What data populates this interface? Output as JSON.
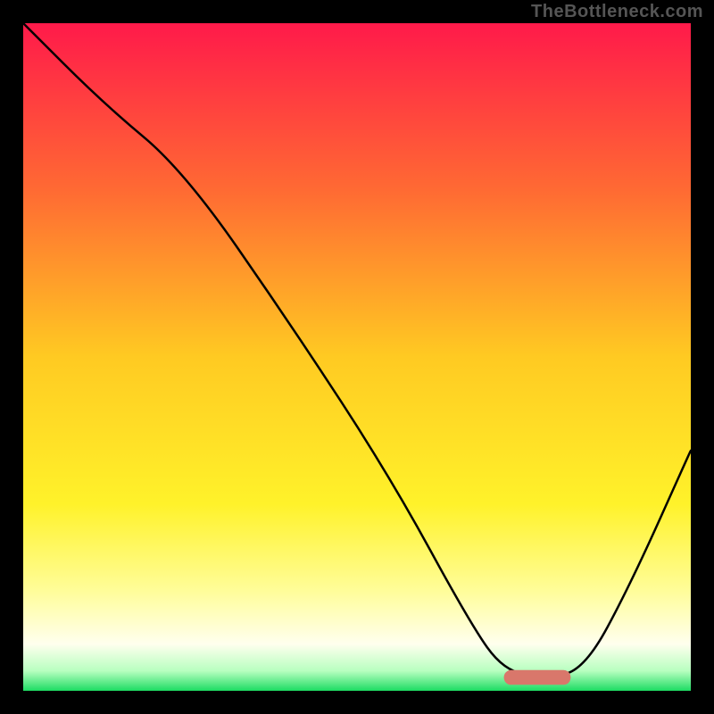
{
  "watermark": "TheBottleneck.com",
  "chart_data": {
    "type": "line",
    "title": "",
    "xlabel": "",
    "ylabel": "",
    "xlim": [
      0,
      100
    ],
    "ylim": [
      0,
      100
    ],
    "grid": false,
    "legend": false,
    "background_gradient": {
      "stops": [
        {
          "offset": 0.0,
          "color": "#ff1a4a"
        },
        {
          "offset": 0.25,
          "color": "#ff6a33"
        },
        {
          "offset": 0.5,
          "color": "#ffca22"
        },
        {
          "offset": 0.72,
          "color": "#fff22a"
        },
        {
          "offset": 0.85,
          "color": "#fffd99"
        },
        {
          "offset": 0.93,
          "color": "#ffffee"
        },
        {
          "offset": 0.97,
          "color": "#b8ffc0"
        },
        {
          "offset": 1.0,
          "color": "#1ddc63"
        }
      ]
    },
    "series": [
      {
        "name": "bottleneck-curve",
        "color": "#000000",
        "x": [
          0,
          12,
          24,
          40,
          55,
          67,
          72,
          78,
          84,
          91,
          100
        ],
        "y": [
          100,
          88,
          78,
          55,
          32,
          10,
          3,
          2,
          3,
          16,
          36
        ]
      }
    ],
    "marker": {
      "name": "optimal-zone",
      "color": "#d9776b",
      "x_start": 72,
      "x_end": 82,
      "y": 2,
      "thickness": 2.2
    },
    "annotations": []
  }
}
